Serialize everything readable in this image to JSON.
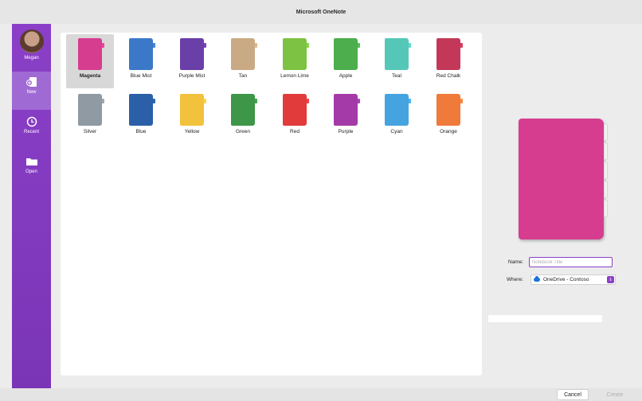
{
  "window": {
    "title": "Microsoft OneNote"
  },
  "sidebar": {
    "account_label": "Megan",
    "items": [
      {
        "label": "New",
        "icon": "new-notebook-icon",
        "active": true
      },
      {
        "label": "Recent",
        "icon": "clock-icon"
      },
      {
        "label": "Open",
        "icon": "folder-icon"
      }
    ]
  },
  "notebooks": [
    {
      "label": "Magenta",
      "color": "#d63d8f",
      "selected": true
    },
    {
      "label": "Blue Mist",
      "color": "#3c78c8"
    },
    {
      "label": "Purple Mist",
      "color": "#6a3fa8"
    },
    {
      "label": "Tan",
      "color": "#c9aa85"
    },
    {
      "label": "Lemon Lime",
      "color": "#7dc242"
    },
    {
      "label": "Apple",
      "color": "#4cae4c"
    },
    {
      "label": "Teal",
      "color": "#55c7b9"
    },
    {
      "label": "Red Chalk",
      "color": "#c33858"
    },
    {
      "label": "Silver",
      "color": "#8f9aa3"
    },
    {
      "label": "Blue",
      "color": "#2b5fa8"
    },
    {
      "label": "Yellow",
      "color": "#f2c23c"
    },
    {
      "label": "Green",
      "color": "#3e9648"
    },
    {
      "label": "Red",
      "color": "#e23b3b"
    },
    {
      "label": "Purple",
      "color": "#a43aa8"
    },
    {
      "label": "Cyan",
      "color": "#45a3e0"
    },
    {
      "label": "Orange",
      "color": "#ef7a3a"
    }
  ],
  "preview": {
    "color": "#d63d8f"
  },
  "form": {
    "name_label": "Name:",
    "name_placeholder": "Notebook Title",
    "name_value": "",
    "where_label": "Where:",
    "where_value": "OneDrive - Contoso"
  },
  "progress": {
    "value": 0
  },
  "footer": {
    "cancel_label": "Cancel",
    "create_label": "Create"
  },
  "colors": {
    "accent": "#8b3fc8"
  }
}
